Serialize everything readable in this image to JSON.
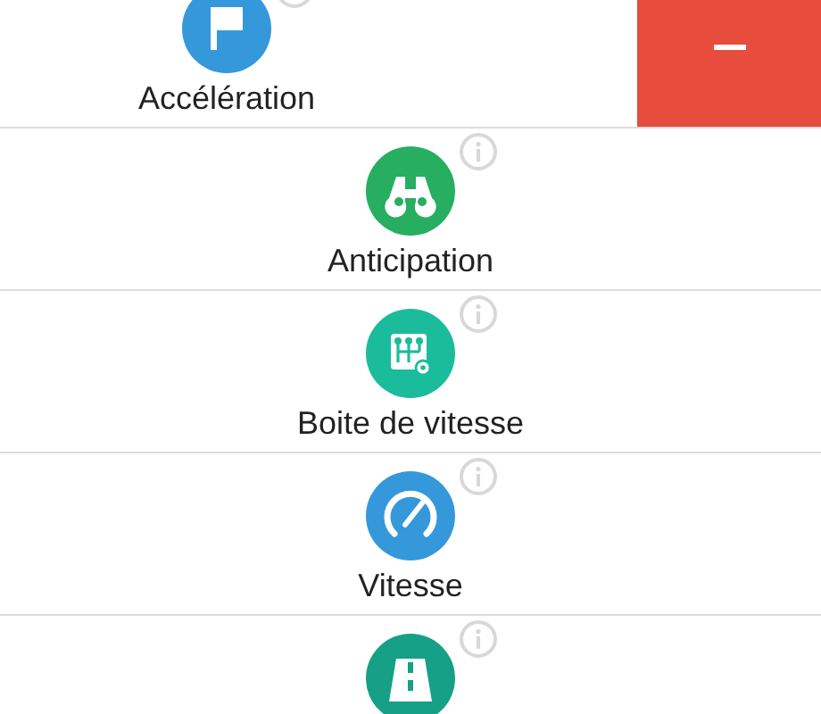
{
  "items": [
    {
      "label": "Accélération",
      "kind": "flag",
      "color": "#3498db",
      "swiped": true
    },
    {
      "label": "Anticipation",
      "kind": "binoculars",
      "color": "#27ae60",
      "swiped": false
    },
    {
      "label": "Boite de vitesse",
      "kind": "gearbox",
      "color": "#1abc9c",
      "swiped": false
    },
    {
      "label": "Vitesse",
      "kind": "speedometer",
      "color": "#3498db",
      "swiped": false
    },
    {
      "kind": "road",
      "color": "#16a085",
      "swiped": false
    }
  ]
}
